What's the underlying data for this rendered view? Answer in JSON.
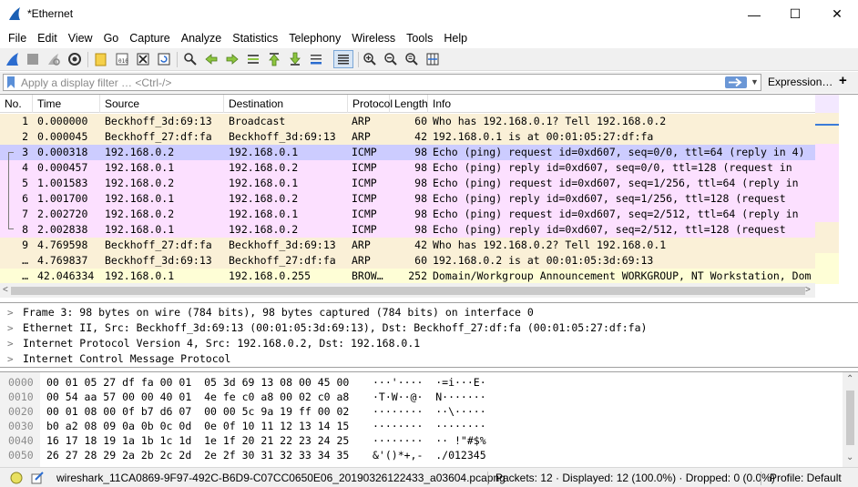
{
  "window": {
    "title": "*Ethernet",
    "minimize_glyph": "—",
    "maximize_glyph": "☐",
    "close_glyph": "✕"
  },
  "menu": [
    "File",
    "Edit",
    "View",
    "Go",
    "Capture",
    "Analyze",
    "Statistics",
    "Telephony",
    "Wireless",
    "Tools",
    "Help"
  ],
  "toolbar": {
    "icons": [
      "shark-fin-start-icon",
      "stop-capture-icon",
      "restart-capture-icon",
      "capture-options-icon",
      "open-file-icon",
      "save-file-icon",
      "close-file-icon",
      "reload-file-icon",
      "find-packet-icon",
      "go-back-icon",
      "go-forward-icon",
      "go-to-packet-icon",
      "first-packet-icon",
      "last-packet-icon",
      "autoscroll-icon",
      "colorize-icon",
      "zoom-in-icon",
      "zoom-out-icon",
      "normal-size-icon",
      "resize-columns-icon"
    ]
  },
  "filter": {
    "placeholder": "Apply a display filter … <Ctrl-/>",
    "value": "",
    "expression_label": "Expression…",
    "add_label": "+"
  },
  "packet_list": {
    "columns": [
      "No.",
      "Time",
      "Source",
      "Destination",
      "Protocol",
      "Length",
      "Info"
    ],
    "colors": {
      "arp": "#faf0d7",
      "icmp": "#fce0ff",
      "selected": "#ccccff",
      "browser": "#fefed6"
    },
    "rows": [
      {
        "no": "1",
        "time": "0.000000",
        "source": "Beckhoff_3d:69:13",
        "destination": "Broadcast",
        "protocol": "ARP",
        "length": "60",
        "info": "Who has 192.168.0.1? Tell 192.168.0.2",
        "kind": "arp"
      },
      {
        "no": "2",
        "time": "0.000045",
        "source": "Beckhoff_27:df:fa",
        "destination": "Beckhoff_3d:69:13",
        "protocol": "ARP",
        "length": "42",
        "info": "192.168.0.1 is at 00:01:05:27:df:fa",
        "kind": "arp"
      },
      {
        "no": "3",
        "time": "0.000318",
        "source": "192.168.0.2",
        "destination": "192.168.0.1",
        "protocol": "ICMP",
        "length": "98",
        "info": "Echo (ping) request  id=0xd607, seq=0/0, ttl=64 (reply in 4)",
        "kind": "selected"
      },
      {
        "no": "4",
        "time": "0.000457",
        "source": "192.168.0.1",
        "destination": "192.168.0.2",
        "protocol": "ICMP",
        "length": "98",
        "info": "Echo (ping) reply    id=0xd607, seq=0/0, ttl=128 (request in",
        "kind": "icmp"
      },
      {
        "no": "5",
        "time": "1.001583",
        "source": "192.168.0.2",
        "destination": "192.168.0.1",
        "protocol": "ICMP",
        "length": "98",
        "info": "Echo (ping) request  id=0xd607, seq=1/256, ttl=64 (reply in",
        "kind": "icmp"
      },
      {
        "no": "6",
        "time": "1.001700",
        "source": "192.168.0.1",
        "destination": "192.168.0.2",
        "protocol": "ICMP",
        "length": "98",
        "info": "Echo (ping) reply    id=0xd607, seq=1/256, ttl=128 (request",
        "kind": "icmp"
      },
      {
        "no": "7",
        "time": "2.002720",
        "source": "192.168.0.2",
        "destination": "192.168.0.1",
        "protocol": "ICMP",
        "length": "98",
        "info": "Echo (ping) request  id=0xd607, seq=2/512, ttl=64 (reply in",
        "kind": "icmp"
      },
      {
        "no": "8",
        "time": "2.002838",
        "source": "192.168.0.1",
        "destination": "192.168.0.2",
        "protocol": "ICMP",
        "length": "98",
        "info": "Echo (ping) reply    id=0xd607, seq=2/512, ttl=128 (request",
        "kind": "icmp"
      },
      {
        "no": "9",
        "time": "4.769598",
        "source": "Beckhoff_27:df:fa",
        "destination": "Beckhoff_3d:69:13",
        "protocol": "ARP",
        "length": "42",
        "info": "Who has 192.168.0.2? Tell 192.168.0.1",
        "kind": "arp"
      },
      {
        "no": "…",
        "time": "4.769837",
        "source": "Beckhoff_3d:69:13",
        "destination": "Beckhoff_27:df:fa",
        "protocol": "ARP",
        "length": "60",
        "info": "192.168.0.2 is at 00:01:05:3d:69:13",
        "kind": "arp"
      },
      {
        "no": "…",
        "time": "42.046334",
        "source": "192.168.0.1",
        "destination": "192.168.0.255",
        "protocol": "BROW…",
        "length": "252",
        "info": "Domain/Workgroup Announcement WORKGROUP, NT Workstation, Dom",
        "kind": "browser"
      }
    ]
  },
  "details": [
    "Frame 3: 98 bytes on wire (784 bits), 98 bytes captured (784 bits) on interface 0",
    "Ethernet II, Src: Beckhoff_3d:69:13 (00:01:05:3d:69:13), Dst: Beckhoff_27:df:fa (00:01:05:27:df:fa)",
    "Internet Protocol Version 4, Src: 192.168.0.2, Dst: 192.168.0.1",
    "Internet Control Message Protocol"
  ],
  "bytes": [
    {
      "offset": "0000",
      "hex": "00 01 05 27 df fa 00 01  05 3d 69 13 08 00 45 00",
      "ascii": "···'····  ·=i···E·"
    },
    {
      "offset": "0010",
      "hex": "00 54 aa 57 00 00 40 01  4e fe c0 a8 00 02 c0 a8",
      "ascii": "·T·W··@·  N·······"
    },
    {
      "offset": "0020",
      "hex": "00 01 08 00 0f b7 d6 07  00 00 5c 9a 19 ff 00 02",
      "ascii": "········  ··\\·····"
    },
    {
      "offset": "0030",
      "hex": "b0 a2 08 09 0a 0b 0c 0d  0e 0f 10 11 12 13 14 15",
      "ascii": "········  ········"
    },
    {
      "offset": "0040",
      "hex": "16 17 18 19 1a 1b 1c 1d  1e 1f 20 21 22 23 24 25",
      "ascii": "········  ·· !\"#$%"
    },
    {
      "offset": "0050",
      "hex": "26 27 28 29 2a 2b 2c 2d  2e 2f 30 31 32 33 34 35",
      "ascii": "&'()*+,-  ./012345"
    }
  ],
  "status": {
    "filename": "wireshark_11CA0869-9F97-492C-B6D9-C07CC0650E06_20190326122433_a03604.pcapng",
    "packets": "Packets: 12 · Displayed: 12 (100.0%) · Dropped: 0 (0.0%)",
    "profile": "Profile: Default"
  }
}
